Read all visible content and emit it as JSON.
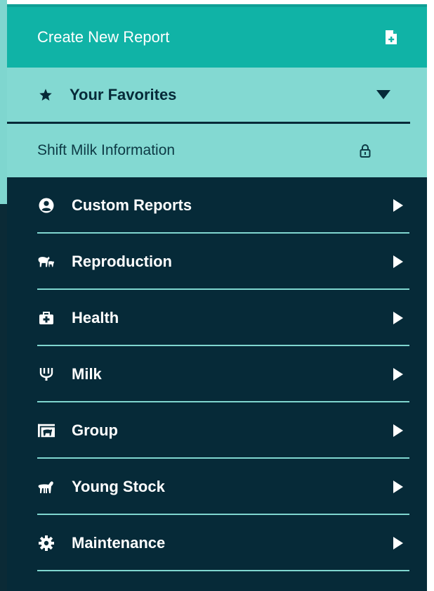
{
  "colors": {
    "create_bg": "#10b3a6",
    "favorites_bg": "#83d9d2",
    "menu_bg": "#062a38",
    "divider": "#7fd6cf",
    "text_light": "#ffffff",
    "text_dark": "#062a38"
  },
  "create": {
    "label": "Create New Report",
    "icon": "file-plus-icon"
  },
  "favorites": {
    "label": "Your Favorites",
    "icon": "star-icon",
    "toggle_icon": "caret-down-icon",
    "items": [
      {
        "label": "Shift Milk Information",
        "icon": "lock-icon"
      }
    ]
  },
  "menu": {
    "items": [
      {
        "label": "Custom Reports",
        "icon": "user-circle-icon"
      },
      {
        "label": "Reproduction",
        "icon": "cow-calf-icon"
      },
      {
        "label": "Health",
        "icon": "medical-kit-icon"
      },
      {
        "label": "Milk",
        "icon": "milking-claw-icon"
      },
      {
        "label": "Group",
        "icon": "pen-group-icon"
      },
      {
        "label": "Young Stock",
        "icon": "calf-icon"
      },
      {
        "label": "Maintenance",
        "icon": "gear-icon"
      }
    ]
  }
}
